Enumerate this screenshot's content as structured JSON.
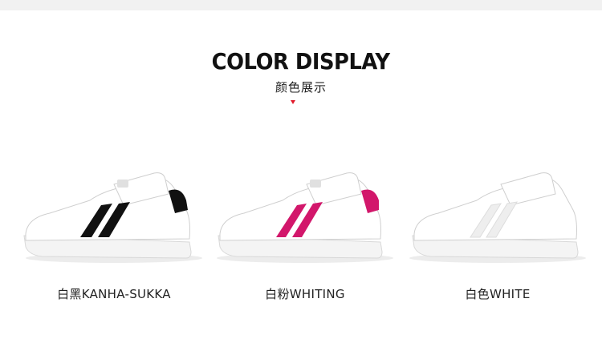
{
  "heading": {
    "title": "COLOR DISPLAY",
    "subtitle": "颜色展示"
  },
  "colors": {
    "marker": "#e11a2b",
    "black_stripe": "#111111",
    "rose_stripe": "#d2176b",
    "white_stripe": "#eeeeee"
  },
  "products": [
    {
      "color_cn": "白黑",
      "color_en": "KANHA-SUKKA"
    },
    {
      "color_cn": "白粉",
      "color_en": "WHITING"
    },
    {
      "color_cn": "白色",
      "color_en": "WHITE"
    }
  ]
}
